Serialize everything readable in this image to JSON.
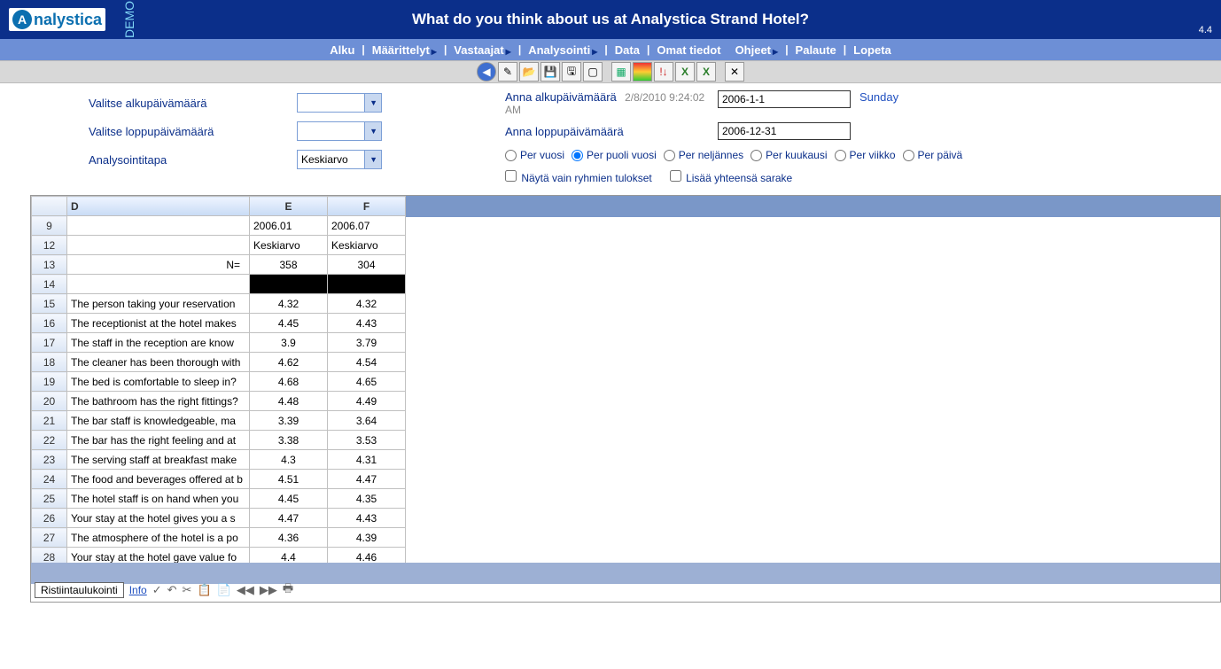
{
  "header": {
    "brand": "nalystica",
    "brand_letter": "A",
    "demo": "DEMO",
    "title": "What do you think about us at Analystica Strand Hotel?",
    "version": "4.4"
  },
  "menu": {
    "alku": "Alku",
    "maarittelyt": "Määrittelyt",
    "vastaajat": "Vastaajat",
    "analysointi": "Analysointi",
    "data": "Data",
    "omat": "Omat tiedot",
    "ohjeet": "Ohjeet",
    "palaute": "Palaute",
    "lopeta": "Lopeta"
  },
  "filters": {
    "valitse_alku_label": "Valitse alkupäivämäärä",
    "valitse_loppu_label": "Valitse loppupäivämäärä",
    "analys_label": "Analysointitapa",
    "analys_value": "Keskiarvo",
    "anna_alku_label": "Anna alkupäivämäärä",
    "anna_alku_ts": "2/8/2010 9:24:02 AM",
    "anna_alku_value": "2006-1-1",
    "anna_alku_day": "Sunday",
    "anna_loppu_label": "Anna loppupäivämäärä",
    "anna_loppu_value": "2006-12-31",
    "radios": {
      "vuosi": "Per vuosi",
      "puoli": "Per puoli vuosi",
      "neljannes": "Per neljännes",
      "kuukausi": "Per kuukausi",
      "viikko": "Per viikko",
      "paiva": "Per päivä"
    },
    "check_ryhmien": "Näytä vain ryhmien tulokset",
    "check_yhteensa": "Lisää yhteensä sarake"
  },
  "grid": {
    "col_D": "D",
    "col_E": "E",
    "col_F": "F",
    "rows": [
      {
        "n": "9",
        "d": "",
        "e": "2006.01",
        "f": "2006.07",
        "eAlign": "left",
        "fAlign": "left"
      },
      {
        "n": "12",
        "d": "",
        "e": "Keskiarvo",
        "f": "Keskiarvo",
        "eAlign": "left",
        "fAlign": "left"
      },
      {
        "n": "13",
        "d": "N=",
        "dAlign": "right",
        "e": "358",
        "f": "304"
      },
      {
        "n": "14",
        "d": "",
        "e": "",
        "f": "",
        "black": true
      },
      {
        "n": "15",
        "d": "The person taking your reservation",
        "e": "4.32",
        "f": "4.32"
      },
      {
        "n": "16",
        "d": "The receptionist at the hotel makes",
        "e": "4.45",
        "f": "4.43"
      },
      {
        "n": "17",
        "d": "The staff  in the reception are know",
        "e": "3.9",
        "f": "3.79"
      },
      {
        "n": "18",
        "d": "The cleaner has been thorough with",
        "e": "4.62",
        "f": "4.54"
      },
      {
        "n": "19",
        "d": "The bed is comfortable to sleep in?",
        "e": "4.68",
        "f": "4.65"
      },
      {
        "n": "20",
        "d": "The bathroom has the right fittings?",
        "e": "4.48",
        "f": "4.49"
      },
      {
        "n": "21",
        "d": "The bar staff is knowledgeable, ma",
        "e": "3.39",
        "f": "3.64"
      },
      {
        "n": "22",
        "d": "The bar has the right feeling and at",
        "e": "3.38",
        "f": "3.53"
      },
      {
        "n": "23",
        "d": "The serving staff at breakfast make",
        "e": "4.3",
        "f": "4.31"
      },
      {
        "n": "24",
        "d": "The food and beverages offered at b",
        "e": "4.51",
        "f": "4.47"
      },
      {
        "n": "25",
        "d": "The hotel staff is on hand when you",
        "e": "4.45",
        "f": "4.35"
      },
      {
        "n": "26",
        "d": "Your stay at the hotel gives you a s",
        "e": "4.47",
        "f": "4.43"
      },
      {
        "n": "27",
        "d": "The atmosphere of the hotel is a po",
        "e": "4.36",
        "f": "4.39"
      },
      {
        "n": "28",
        "d": "Your stay at the hotel gave value fo",
        "e": "4.4",
        "f": "4.46"
      }
    ]
  },
  "bottom": {
    "tab": "Ristiintaulukointi",
    "info": "Info"
  }
}
